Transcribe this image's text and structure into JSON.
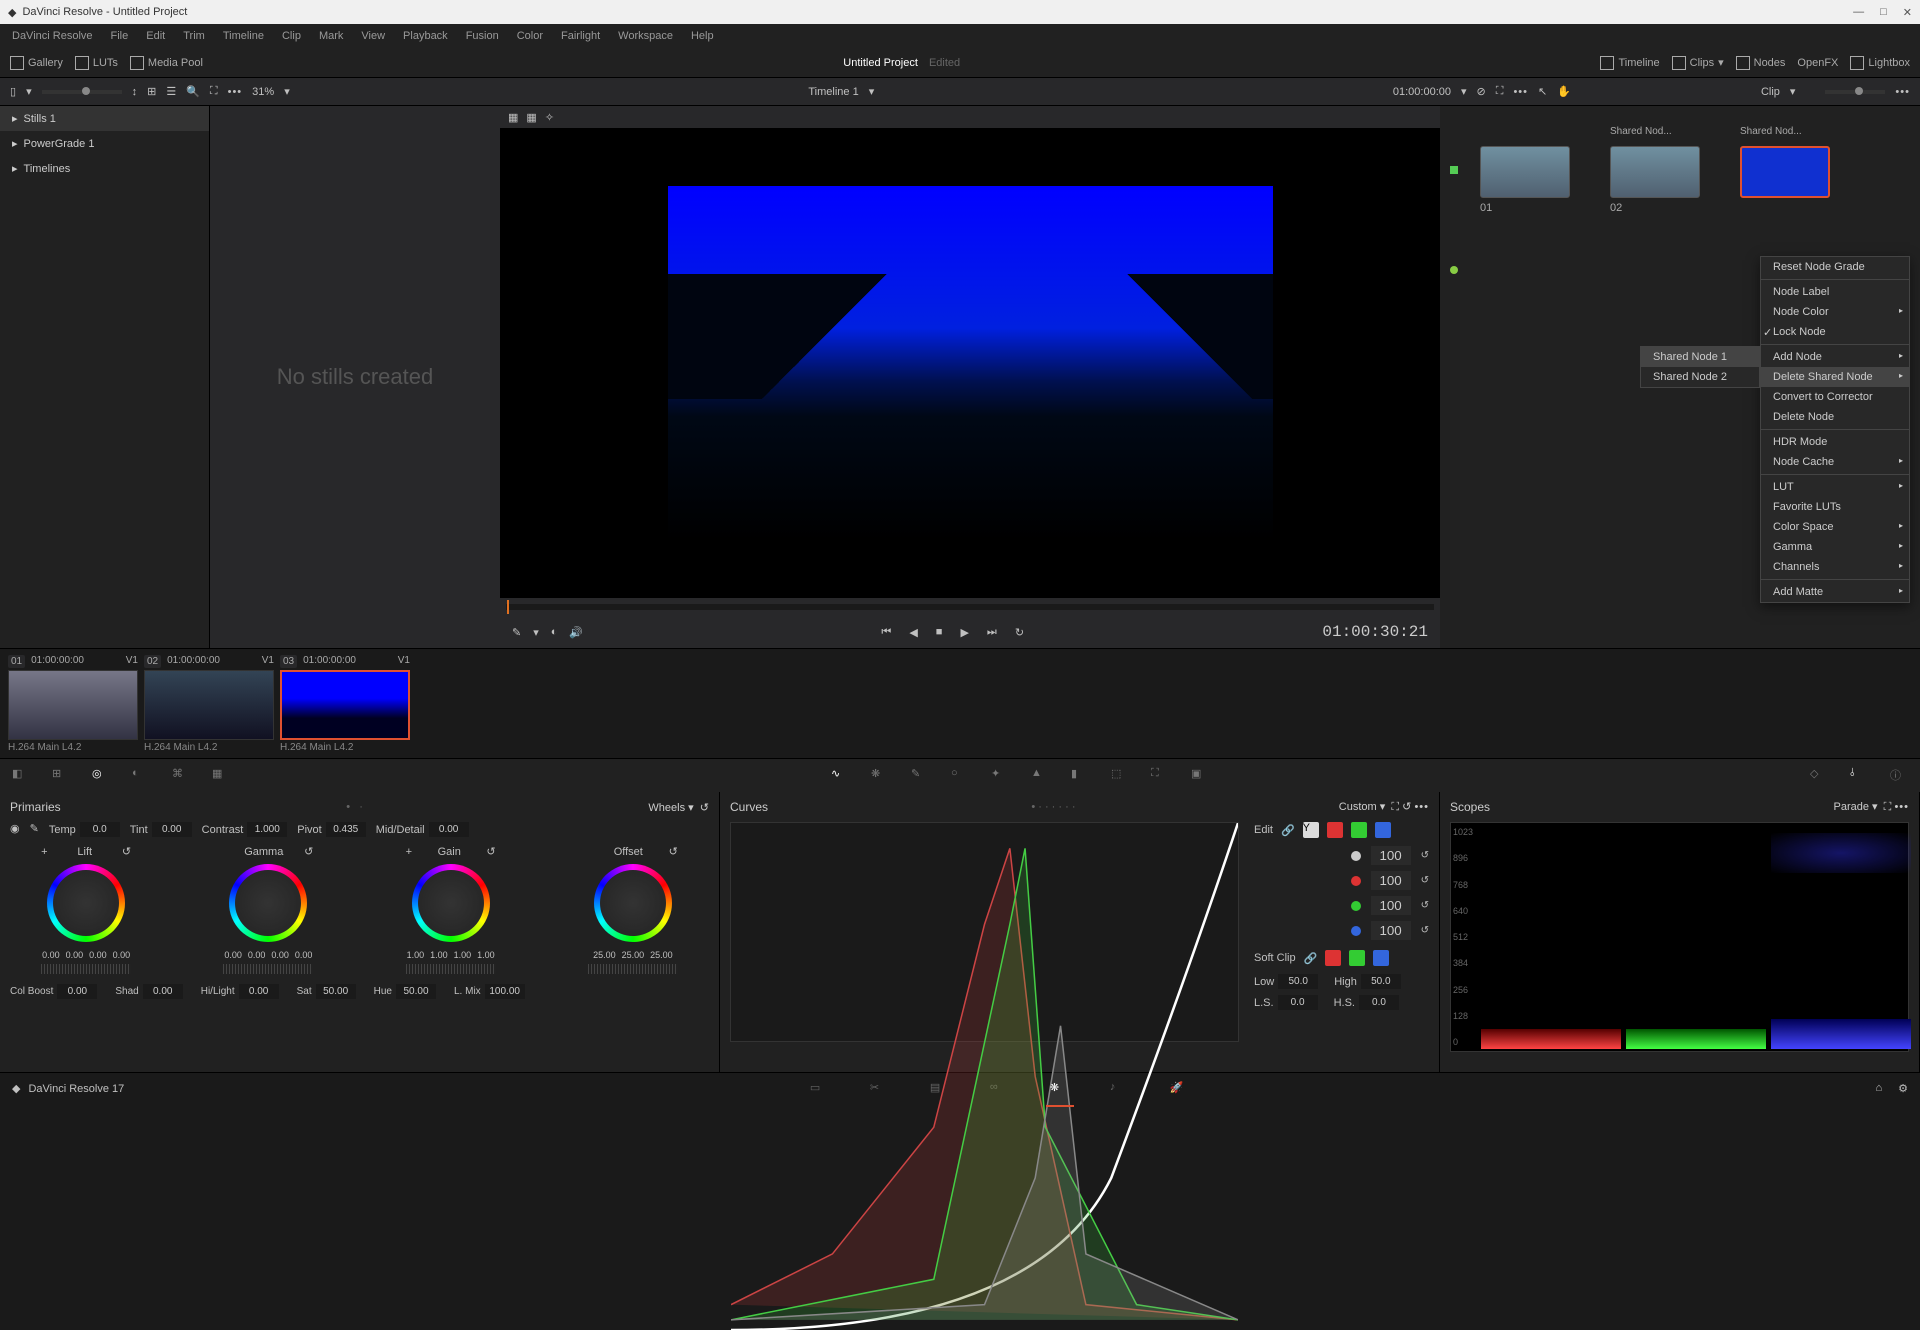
{
  "titlebar": {
    "app": "DaVinci Resolve - Untitled Project"
  },
  "menubar": [
    "DaVinci Resolve",
    "File",
    "Edit",
    "Trim",
    "Timeline",
    "Clip",
    "Mark",
    "View",
    "Playback",
    "Fusion",
    "Color",
    "Fairlight",
    "Workspace",
    "Help"
  ],
  "toolbar": {
    "gallery": "Gallery",
    "luts": "LUTs",
    "mediapool": "Media Pool",
    "project": "Untitled Project",
    "edited": "Edited",
    "timeline": "Timeline",
    "clips": "Clips",
    "nodes": "Nodes",
    "openfx": "OpenFX",
    "lightbox": "Lightbox"
  },
  "subtoolbar": {
    "zoom": "31%",
    "timeline_name": "Timeline 1",
    "timecode": "01:00:00:00",
    "clip_mode": "Clip"
  },
  "gallery": {
    "tabs": [
      "Stills 1",
      "PowerGrade 1",
      "Timelines"
    ],
    "empty": "No stills created"
  },
  "viewer": {
    "timecode": "01:00:30:21"
  },
  "nodes": {
    "node1": {
      "label": "",
      "num": "01"
    },
    "node2": {
      "label": "Shared Nod...",
      "num": "02"
    },
    "node3": {
      "label": "Shared Nod..."
    }
  },
  "context_menu": [
    "Reset Node Grade",
    "Node Label",
    "Node Color",
    "Lock Node",
    "Add Node",
    "Delete Shared Node",
    "Convert to Corrector",
    "Delete Node",
    "HDR Mode",
    "Node Cache",
    "LUT",
    "Favorite LUTs",
    "Color Space",
    "Gamma",
    "Channels",
    "Add Matte"
  ],
  "context_sub": [
    "Shared Node 1",
    "Shared Node 2"
  ],
  "clips": [
    {
      "badge": "01",
      "tc": "01:00:00:00",
      "track": "V1",
      "codec": "H.264 Main L4.2"
    },
    {
      "badge": "02",
      "tc": "01:00:00:00",
      "track": "V1",
      "codec": "H.264 Main L4.2"
    },
    {
      "badge": "03",
      "tc": "01:00:00:00",
      "track": "V1",
      "codec": "H.264 Main L4.2"
    }
  ],
  "primaries": {
    "title": "Primaries",
    "mode": "Wheels",
    "temp_l": "Temp",
    "temp": "0.0",
    "tint_l": "Tint",
    "tint": "0.00",
    "contrast_l": "Contrast",
    "contrast": "1.000",
    "pivot_l": "Pivot",
    "pivot": "0.435",
    "md_l": "Mid/Detail",
    "md": "0.00",
    "wheels": [
      {
        "name": "Lift",
        "vals": [
          "0.00",
          "0.00",
          "0.00",
          "0.00"
        ]
      },
      {
        "name": "Gamma",
        "vals": [
          "0.00",
          "0.00",
          "0.00",
          "0.00"
        ]
      },
      {
        "name": "Gain",
        "vals": [
          "1.00",
          "1.00",
          "1.00",
          "1.00"
        ]
      },
      {
        "name": "Offset",
        "vals": [
          "25.00",
          "25.00",
          "25.00"
        ]
      }
    ],
    "cb_l": "Col Boost",
    "cb": "0.00",
    "shad_l": "Shad",
    "shad": "0.00",
    "hl_l": "Hi/Light",
    "hl": "0.00",
    "sat_l": "Sat",
    "sat": "50.00",
    "hue_l": "Hue",
    "hue": "50.00",
    "lmix_l": "L. Mix",
    "lmix": "100.00"
  },
  "curves": {
    "title": "Curves",
    "mode": "Custom",
    "edit": "Edit",
    "vals": [
      "100",
      "100",
      "100",
      "100"
    ],
    "softclip": "Soft Clip",
    "low_l": "Low",
    "low": "50.0",
    "high_l": "High",
    "high": "50.0",
    "ls_l": "L.S.",
    "ls": "0.0",
    "hs_l": "H.S.",
    "hs": "0.0"
  },
  "scopes": {
    "title": "Scopes",
    "mode": "Parade",
    "axis": [
      "1023",
      "896",
      "768",
      "640",
      "512",
      "384",
      "256",
      "128",
      "0"
    ]
  },
  "footer": {
    "version": "DaVinci Resolve 17"
  }
}
